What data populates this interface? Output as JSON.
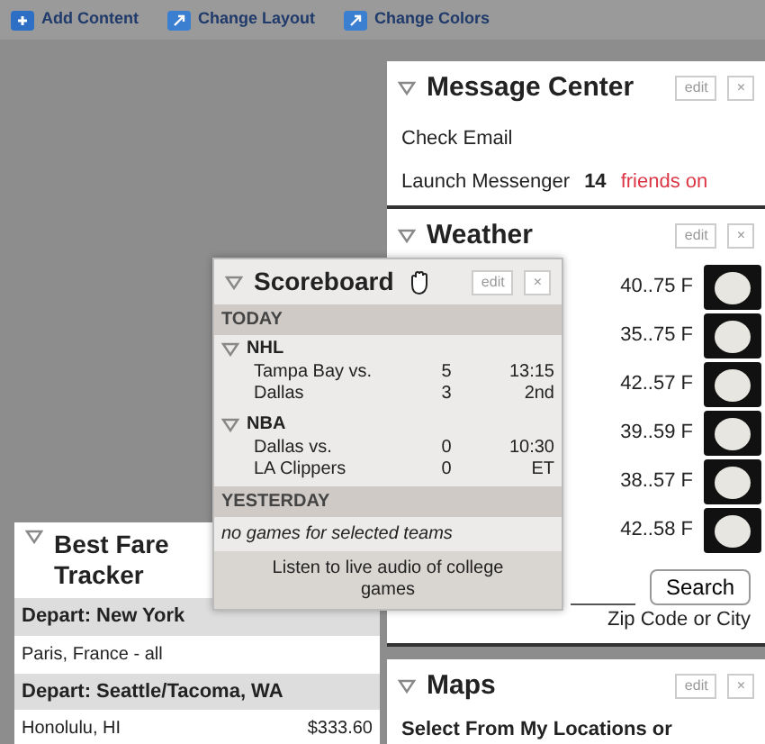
{
  "toolbar": [
    {
      "label": "Add Content",
      "kind": "add"
    },
    {
      "label": "Change Layout",
      "kind": "layout"
    },
    {
      "label": "Change Colors",
      "kind": "colors"
    }
  ],
  "message_center": {
    "title": "Message Center",
    "edit": "edit",
    "close": "×",
    "rows": [
      {
        "text": "Check Email"
      },
      {
        "text": "Launch Messenger",
        "count": "14",
        "status": "friends on"
      }
    ]
  },
  "weather": {
    "title": "Weather",
    "edit": "edit",
    "close": "×",
    "rows": [
      {
        "temp": "40..75 F"
      },
      {
        "temp": "35..75 F"
      },
      {
        "temp": "42..57 F"
      },
      {
        "temp": "39..59 F"
      },
      {
        "temp": "38..57 F"
      },
      {
        "temp": "42..58 F"
      }
    ],
    "search_button": "Search",
    "hint": "Zip Code or City"
  },
  "maps": {
    "title": "Maps",
    "edit": "edit",
    "close": "×",
    "text": "Select From My Locations or"
  },
  "fare_tracker": {
    "title": "Best Fare Tracker",
    "rows": [
      {
        "kind": "header",
        "text": "Depart: New York"
      },
      {
        "kind": "fare",
        "text": "Paris, France - all"
      },
      {
        "kind": "header",
        "text": "Depart: Seattle/Tacoma, WA"
      },
      {
        "kind": "fare",
        "text": "Honolulu, HI",
        "price": "$333.60"
      }
    ]
  },
  "scoreboard": {
    "title": "Scoreboard",
    "edit": "edit",
    "close": "×",
    "sections": [
      {
        "label": "TODAY",
        "leagues": [
          {
            "name": "NHL",
            "games": [
              {
                "team": "Tampa Bay vs.",
                "score": "5",
                "time": "13:15"
              },
              {
                "team": "Dallas",
                "score": "3",
                "time": "2nd"
              }
            ]
          },
          {
            "name": "NBA",
            "games": [
              {
                "team": "Dallas vs.",
                "score": "0",
                "time": "10:30"
              },
              {
                "team": "LA Clippers",
                "score": "0",
                "time": "ET"
              }
            ]
          }
        ]
      },
      {
        "label": "YESTERDAY",
        "message": "no games for selected teams"
      }
    ],
    "footer": "Listen to live audio of college games"
  }
}
